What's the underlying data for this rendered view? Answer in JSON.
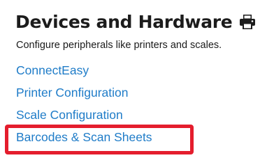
{
  "header": {
    "title": "Devices and Hardware",
    "print_icon": "printer-icon",
    "subtitle": "Configure peripherals like printers and scales."
  },
  "links": [
    {
      "label": "ConnectEasy"
    },
    {
      "label": "Printer Configuration"
    },
    {
      "label": "Scale Configuration"
    },
    {
      "label": "Barcodes & Scan Sheets"
    }
  ],
  "colors": {
    "link": "#1f7cc8",
    "title": "#1c1c1c",
    "highlight": "#e41d2d"
  }
}
